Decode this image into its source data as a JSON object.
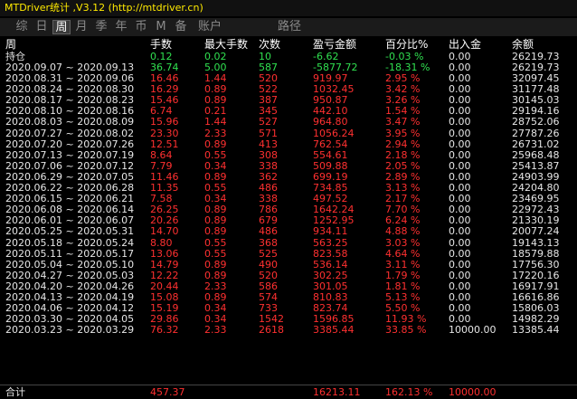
{
  "window": {
    "title": "MTDriver统计 ,V3.12 (http://mtdriver.cn)"
  },
  "tabs": [
    {
      "label": "综",
      "active": false
    },
    {
      "label": "日",
      "active": false
    },
    {
      "label": "周",
      "active": true
    },
    {
      "label": "月",
      "active": false
    },
    {
      "label": "季",
      "active": false
    },
    {
      "label": "年",
      "active": false
    },
    {
      "label": "币",
      "active": false
    },
    {
      "label": "M",
      "active": false
    },
    {
      "label": "备",
      "active": false
    },
    {
      "label": "账户",
      "active": false
    },
    {
      "label": "路径",
      "active": false
    }
  ],
  "columns": {
    "period": "周",
    "hands": "手数",
    "maxhands": "最大手数",
    "count": "次数",
    "pnl": "盈亏金额",
    "pct": "百分比%",
    "inout": "出入金",
    "balance": "余额"
  },
  "colors": {
    "positive": "#ff3030",
    "negative": "#30e050",
    "neutral": "#e6e6e6",
    "title": "#ffea00"
  },
  "holding": {
    "label": "持仓",
    "hands": "0.12",
    "maxhands": "0.02",
    "count": "10",
    "pnl": "-6.62",
    "pct": "-0.03 %",
    "inout": "0.00",
    "balance": "26219.73",
    "tone": "negative"
  },
  "rows": [
    {
      "period": "2020.09.07 ~ 2020.09.13",
      "hands": "36.74",
      "maxhands": "5.00",
      "count": "587",
      "pnl": "-5877.72",
      "pct": "-18.31 %",
      "inout": "0.00",
      "balance": "26219.73",
      "tone": "negative"
    },
    {
      "period": "2020.08.31 ~ 2020.09.06",
      "hands": "16.46",
      "maxhands": "1.44",
      "count": "520",
      "pnl": "919.97",
      "pct": "2.95 %",
      "inout": "0.00",
      "balance": "32097.45",
      "tone": "positive"
    },
    {
      "period": "2020.08.24 ~ 2020.08.30",
      "hands": "16.29",
      "maxhands": "0.89",
      "count": "522",
      "pnl": "1032.45",
      "pct": "3.42 %",
      "inout": "0.00",
      "balance": "31177.48",
      "tone": "positive"
    },
    {
      "period": "2020.08.17 ~ 2020.08.23",
      "hands": "15.46",
      "maxhands": "0.89",
      "count": "387",
      "pnl": "950.87",
      "pct": "3.26 %",
      "inout": "0.00",
      "balance": "30145.03",
      "tone": "positive"
    },
    {
      "period": "2020.08.10 ~ 2020.08.16",
      "hands": "6.74",
      "maxhands": "0.21",
      "count": "345",
      "pnl": "442.10",
      "pct": "1.54 %",
      "inout": "0.00",
      "balance": "29194.16",
      "tone": "positive"
    },
    {
      "period": "2020.08.03 ~ 2020.08.09",
      "hands": "15.96",
      "maxhands": "1.44",
      "count": "527",
      "pnl": "964.80",
      "pct": "3.47 %",
      "inout": "0.00",
      "balance": "28752.06",
      "tone": "positive"
    },
    {
      "period": "2020.07.27 ~ 2020.08.02",
      "hands": "23.30",
      "maxhands": "2.33",
      "count": "571",
      "pnl": "1056.24",
      "pct": "3.95 %",
      "inout": "0.00",
      "balance": "27787.26",
      "tone": "positive"
    },
    {
      "period": "2020.07.20 ~ 2020.07.26",
      "hands": "12.51",
      "maxhands": "0.89",
      "count": "413",
      "pnl": "762.54",
      "pct": "2.94 %",
      "inout": "0.00",
      "balance": "26731.02",
      "tone": "positive"
    },
    {
      "period": "2020.07.13 ~ 2020.07.19",
      "hands": "8.64",
      "maxhands": "0.55",
      "count": "308",
      "pnl": "554.61",
      "pct": "2.18 %",
      "inout": "0.00",
      "balance": "25968.48",
      "tone": "positive"
    },
    {
      "period": "2020.07.06 ~ 2020.07.12",
      "hands": "7.79",
      "maxhands": "0.34",
      "count": "338",
      "pnl": "509.88",
      "pct": "2.05 %",
      "inout": "0.00",
      "balance": "25413.87",
      "tone": "positive"
    },
    {
      "period": "2020.06.29 ~ 2020.07.05",
      "hands": "11.46",
      "maxhands": "0.89",
      "count": "362",
      "pnl": "699.19",
      "pct": "2.89 %",
      "inout": "0.00",
      "balance": "24903.99",
      "tone": "positive"
    },
    {
      "period": "2020.06.22 ~ 2020.06.28",
      "hands": "11.35",
      "maxhands": "0.55",
      "count": "486",
      "pnl": "734.85",
      "pct": "3.13 %",
      "inout": "0.00",
      "balance": "24204.80",
      "tone": "positive"
    },
    {
      "period": "2020.06.15 ~ 2020.06.21",
      "hands": "7.58",
      "maxhands": "0.34",
      "count": "338",
      "pnl": "497.52",
      "pct": "2.17 %",
      "inout": "0.00",
      "balance": "23469.95",
      "tone": "positive"
    },
    {
      "period": "2020.06.08 ~ 2020.06.14",
      "hands": "26.25",
      "maxhands": "0.89",
      "count": "786",
      "pnl": "1642.24",
      "pct": "7.70 %",
      "inout": "0.00",
      "balance": "22972.43",
      "tone": "positive"
    },
    {
      "period": "2020.06.01 ~ 2020.06.07",
      "hands": "20.26",
      "maxhands": "0.89",
      "count": "679",
      "pnl": "1252.95",
      "pct": "6.24 %",
      "inout": "0.00",
      "balance": "21330.19",
      "tone": "positive"
    },
    {
      "period": "2020.05.25 ~ 2020.05.31",
      "hands": "14.70",
      "maxhands": "0.89",
      "count": "486",
      "pnl": "934.11",
      "pct": "4.88 %",
      "inout": "0.00",
      "balance": "20077.24",
      "tone": "positive"
    },
    {
      "period": "2020.05.18 ~ 2020.05.24",
      "hands": "8.80",
      "maxhands": "0.55",
      "count": "368",
      "pnl": "563.25",
      "pct": "3.03 %",
      "inout": "0.00",
      "balance": "19143.13",
      "tone": "positive"
    },
    {
      "period": "2020.05.11 ~ 2020.05.17",
      "hands": "13.06",
      "maxhands": "0.55",
      "count": "525",
      "pnl": "823.58",
      "pct": "4.64 %",
      "inout": "0.00",
      "balance": "18579.88",
      "tone": "positive"
    },
    {
      "period": "2020.05.04 ~ 2020.05.10",
      "hands": "14.79",
      "maxhands": "0.89",
      "count": "490",
      "pnl": "536.14",
      "pct": "3.11 %",
      "inout": "0.00",
      "balance": "17756.30",
      "tone": "positive"
    },
    {
      "period": "2020.04.27 ~ 2020.05.03",
      "hands": "12.22",
      "maxhands": "0.89",
      "count": "520",
      "pnl": "302.25",
      "pct": "1.79 %",
      "inout": "0.00",
      "balance": "17220.16",
      "tone": "positive"
    },
    {
      "period": "2020.04.20 ~ 2020.04.26",
      "hands": "20.44",
      "maxhands": "2.33",
      "count": "586",
      "pnl": "301.05",
      "pct": "1.81 %",
      "inout": "0.00",
      "balance": "16917.91",
      "tone": "positive"
    },
    {
      "period": "2020.04.13 ~ 2020.04.19",
      "hands": "15.08",
      "maxhands": "0.89",
      "count": "574",
      "pnl": "810.83",
      "pct": "5.13 %",
      "inout": "0.00",
      "balance": "16616.86",
      "tone": "positive"
    },
    {
      "period": "2020.04.06 ~ 2020.04.12",
      "hands": "15.19",
      "maxhands": "0.34",
      "count": "733",
      "pnl": "823.74",
      "pct": "5.50 %",
      "inout": "0.00",
      "balance": "15806.03",
      "tone": "positive"
    },
    {
      "period": "2020.03.30 ~ 2020.04.05",
      "hands": "29.86",
      "maxhands": "0.34",
      "count": "1542",
      "pnl": "1596.85",
      "pct": "11.93 %",
      "inout": "0.00",
      "balance": "14982.29",
      "tone": "positive"
    },
    {
      "period": "2020.03.23 ~ 2020.03.29",
      "hands": "76.32",
      "maxhands": "2.33",
      "count": "2618",
      "pnl": "3385.44",
      "pct": "33.85 %",
      "inout": "10000.00",
      "balance": "13385.44",
      "tone": "positive"
    }
  ],
  "total": {
    "label": "合计",
    "hands": "457.37",
    "maxhands": "",
    "count": "",
    "pnl": "16213.11",
    "pct": "162.13 %",
    "inout": "10000.00",
    "balance": "",
    "tone": "positive"
  }
}
